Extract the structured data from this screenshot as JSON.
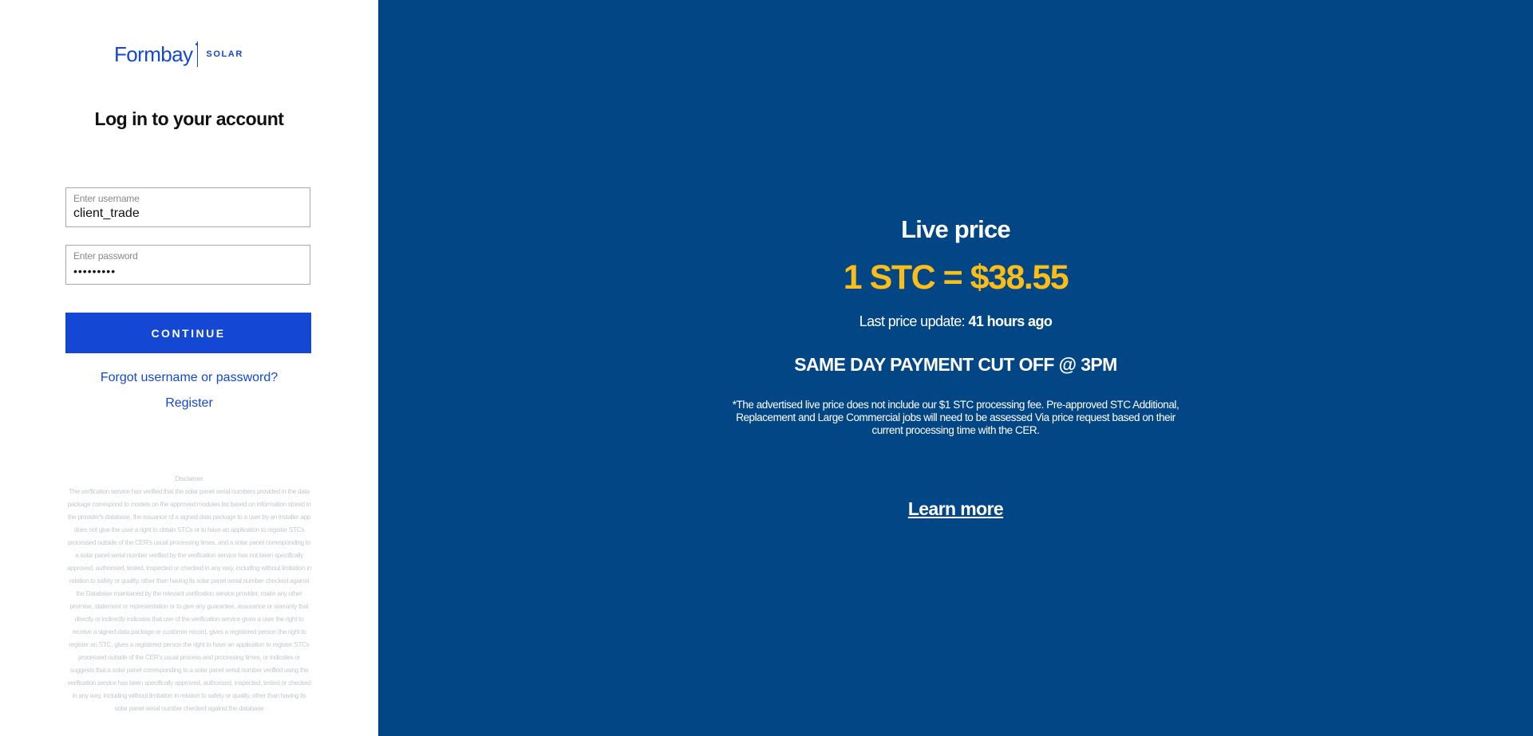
{
  "brand": {
    "name": "Formbay",
    "tagline": "SOLAR"
  },
  "login": {
    "title": "Log in to your account",
    "username": {
      "label": "Enter username",
      "value": "client_trade"
    },
    "password": {
      "label": "Enter password",
      "value": "•••••••••"
    },
    "continue_label": "CONTINUE",
    "forgot_label": "Forgot username or password?",
    "register_label": "Register"
  },
  "disclaimer": {
    "title": "Disclaimer",
    "text": "The verification service has verified that the solar panel serial numbers provided in the data package correspond to models on the approved modules list based on information stored in the provider's database, the issuance of a signed data package to a user by an installer app does not give the user a right to obtain STCs or to have an application to register STCs processed outside of the CER's usual processing times, and a solar panel corresponding to a solar panel serial number verified by the verification service has not been specifically approved, authorised, tested, inspected or checked in any way, including without limitation in relation to safety or quality, other than having its solar panel serial number checked against the Database maintained by the relevant verification service provider, make any other promise, statement or representation or to give any guarantee, assurance or warranty that directly or indirectly indicates that use of the verification service gives a user the right to receive a signed data package or customer record, gives a registered person the right to register an STC, gives a registered person the right to have an application to register STCs processed outside of the CER's usual process and processing times, or indicates or suggests that a solar panel corresponding to a solar panel serial number verified using the verification service has been specifically approved, authorised, inspected, tested or checked in any way, including without limitation in relation to safety or quality, other than having its solar panel serial number checked against the database"
  },
  "live_price": {
    "title": "Live price",
    "price": "1 STC = $38.55",
    "last_update_prefix": "Last price update: ",
    "last_update_value": "41 hours ago",
    "cutoff": "SAME DAY PAYMENT CUT OFF @ 3PM",
    "note": "*The advertised live price does not include our $1 STC processing fee. Pre-approved STC Additional, Replacement and Large Commercial jobs will need to be assessed Via price request based on their current processing time with the CER.",
    "learn_more_label": "Learn more"
  },
  "colors": {
    "brand_blue": "#1347d4",
    "panel_blue": "#034686",
    "price_yellow": "#fbbd17"
  }
}
